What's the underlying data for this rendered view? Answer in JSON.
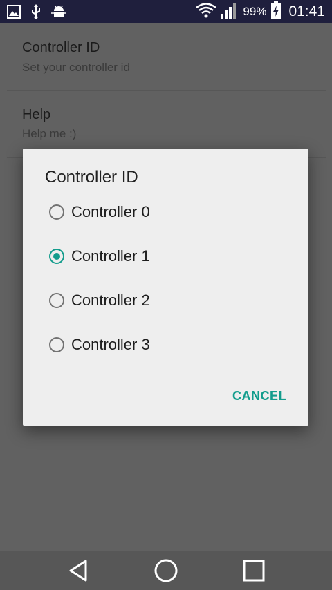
{
  "status_bar": {
    "icons_left": [
      "image-icon",
      "usb-icon",
      "android-debug-icon"
    ],
    "icons_right": [
      "wifi-icon",
      "signal-icon",
      "battery-charging-icon"
    ],
    "battery_percent": "99%",
    "time": "01:41"
  },
  "settings": {
    "items": [
      {
        "title": "Controller ID",
        "summary": "Set your controller id"
      },
      {
        "title": "Help",
        "summary": "Help me :)"
      }
    ]
  },
  "dialog": {
    "title": "Controller ID",
    "options": [
      {
        "label": "Controller 0",
        "selected": false
      },
      {
        "label": "Controller 1",
        "selected": true
      },
      {
        "label": "Controller 2",
        "selected": false
      },
      {
        "label": "Controller 3",
        "selected": false
      }
    ],
    "cancel_label": "CANCEL",
    "accent_color": "#129c8c"
  },
  "nav_bar": {
    "buttons": [
      "back-icon",
      "home-icon",
      "recents-icon"
    ]
  }
}
